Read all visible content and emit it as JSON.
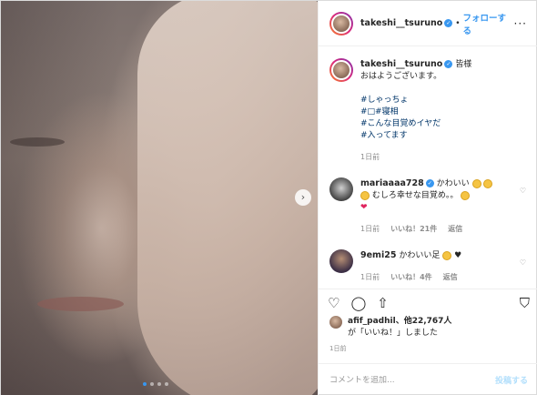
{
  "post": {
    "next_glyph": "›",
    "carousel": {
      "count": 4,
      "active_index": 0
    }
  },
  "header": {
    "username": "takeshi__tsuruno",
    "separator": "•",
    "follow_label": "フォローする",
    "more_glyph": "···",
    "verified_glyph": "✓"
  },
  "caption": {
    "username": "takeshi__tsuruno",
    "text": "皆様",
    "text2": "おはようございます。",
    "hashtags": [
      "#しゃっちょ",
      "#□#寝相",
      "#こんな目覚めイヤだ",
      "#入ってます"
    ],
    "time": "1日前"
  },
  "comments": [
    {
      "username": "mariaaaa728",
      "text": "かわいい",
      "text2": "むしろ幸せな目覚め。。",
      "time": "1日前",
      "likes": "いいね！21件",
      "reply": "返信"
    },
    {
      "username": "9emi25",
      "text": "かわいい足",
      "time": "1日前",
      "likes": "いいね！4件",
      "reply": "返信"
    }
  ],
  "likes": {
    "line1": "afif_padhil、他22,767人",
    "line2": "が「いいね！」しました",
    "time": "1日前"
  },
  "compose": {
    "placeholder": "コメントを追加...",
    "post_label": "投稿する"
  },
  "icons": {
    "heart": "♡",
    "comment": "◯",
    "share": "⇧",
    "bookmark": "⛉",
    "small_heart": "♡",
    "red_heart": "❤",
    "black_heart": "♥"
  },
  "colors": {
    "link_blue": "#3897f0",
    "hashtag": "#003569",
    "muted": "#8e8e8e"
  }
}
